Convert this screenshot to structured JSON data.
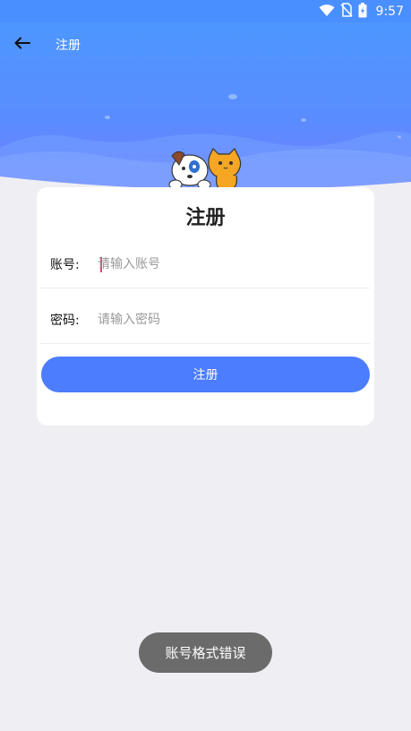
{
  "status_bar": {
    "time": "9:57",
    "icons": [
      "wifi-icon",
      "no-sim-icon",
      "battery-charging-icon"
    ]
  },
  "header": {
    "title": "注册",
    "back_icon": "arrow-left-icon"
  },
  "card": {
    "title": "注册",
    "account": {
      "label": "账号:",
      "placeholder": "请输入账号",
      "value": ""
    },
    "password": {
      "label": "密码:",
      "placeholder": "请输入密码",
      "value": ""
    },
    "submit_label": "注册"
  },
  "toast": {
    "message": "账号格式错误"
  },
  "colors": {
    "primary": "#4b7dfe",
    "hero_top": "#4d97ff",
    "hero_bottom": "#7a7cff",
    "page_bg": "#efeef3",
    "toast_bg": "#6b6b6b"
  }
}
